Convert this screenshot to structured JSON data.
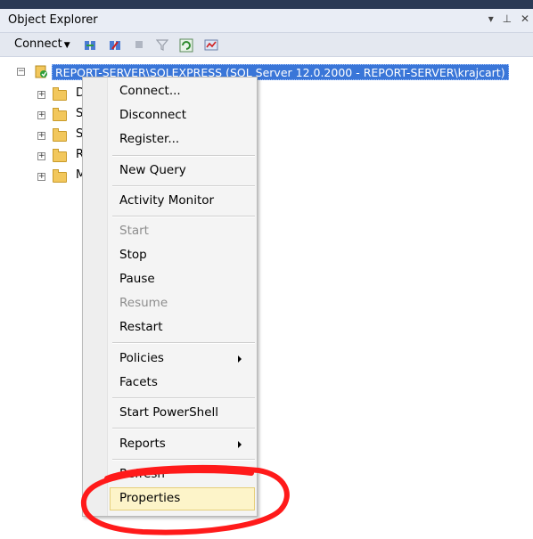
{
  "panel": {
    "title": "Object Explorer",
    "pin_glyph": "▾ ⊥ ✕"
  },
  "toolbar": {
    "connect_label": "Connect",
    "icons": [
      "connect-server-icon",
      "disconnect-server-icon",
      "stop-icon",
      "filter-icon",
      "refresh-icon",
      "activity-monitor-icon"
    ]
  },
  "tree": {
    "server_label": "REPORT-SERVER\\SQLEXPRESS (SQL Server 12.0.2000 - REPORT-SERVER\\krajcart)",
    "children_initials": [
      "D",
      "S",
      "S",
      "R",
      "M"
    ]
  },
  "context_menu": {
    "items": [
      {
        "label": "Connect...",
        "enabled": true
      },
      {
        "label": "Disconnect",
        "enabled": true
      },
      {
        "label": "Register...",
        "enabled": true
      },
      {
        "label": "New Query",
        "enabled": true
      },
      {
        "label": "Activity Monitor",
        "enabled": true
      },
      {
        "label": "Start",
        "enabled": false
      },
      {
        "label": "Stop",
        "enabled": true
      },
      {
        "label": "Pause",
        "enabled": true
      },
      {
        "label": "Resume",
        "enabled": false
      },
      {
        "label": "Restart",
        "enabled": true
      },
      {
        "label": "Policies",
        "enabled": true,
        "submenu": true
      },
      {
        "label": "Facets",
        "enabled": true
      },
      {
        "label": "Start PowerShell",
        "enabled": true
      },
      {
        "label": "Reports",
        "enabled": true,
        "submenu": true
      },
      {
        "label": "Refresh",
        "enabled": true
      },
      {
        "label": "Properties",
        "enabled": true,
        "highlighted": true
      }
    ]
  },
  "colors": {
    "selection": "#3a76d8",
    "highlight": "#fdf4c9",
    "annotation": "#ff1a1a"
  }
}
